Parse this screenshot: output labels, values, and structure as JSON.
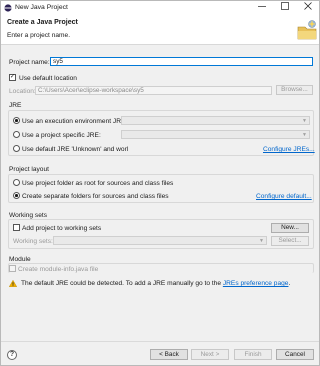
{
  "window": {
    "title": "New Java Project"
  },
  "header": {
    "title": "Create a Java Project",
    "message": "Enter a project name."
  },
  "project": {
    "name_label": "Project name:",
    "name_value": "sy5",
    "use_default_location_label": "Use default location",
    "location_label": "Location:",
    "location_value": "C:\\Users\\Acer\\eclipse-workspace\\sy5",
    "browse_label": "Browse..."
  },
  "jre": {
    "group_title": "JRE",
    "option_env_label": "Use an execution environment JRE:",
    "option_specific_label": "Use a project specific JRE:",
    "option_default_label": "Use default JRE 'Unknown' and worl",
    "configure_link": "Configure JREs..."
  },
  "layout": {
    "group_title": "Project layout",
    "option_root_label": "Use project folder as root for sources and class files",
    "option_separate_label": "Create separate folders for sources and class files",
    "configure_link": "Configure default..."
  },
  "working_sets": {
    "group_title": "Working sets",
    "add_label": "Add project to working sets",
    "new_button": "New...",
    "sets_label": "Working sets:",
    "select_button": "Select..."
  },
  "module": {
    "group_title": "Module",
    "create_label": "Create module-info.java file"
  },
  "warning": {
    "text": "The default JRE could be detected. To add a JRE manually go to the",
    "link": "JREs preference page",
    "suffix": "."
  },
  "footer": {
    "back": "< Back",
    "next": "Next >",
    "finish": "Finish",
    "cancel": "Cancel"
  },
  "colors": {
    "link": "#0066cc",
    "warning": "#f2b100",
    "focus": "#0078d7"
  }
}
